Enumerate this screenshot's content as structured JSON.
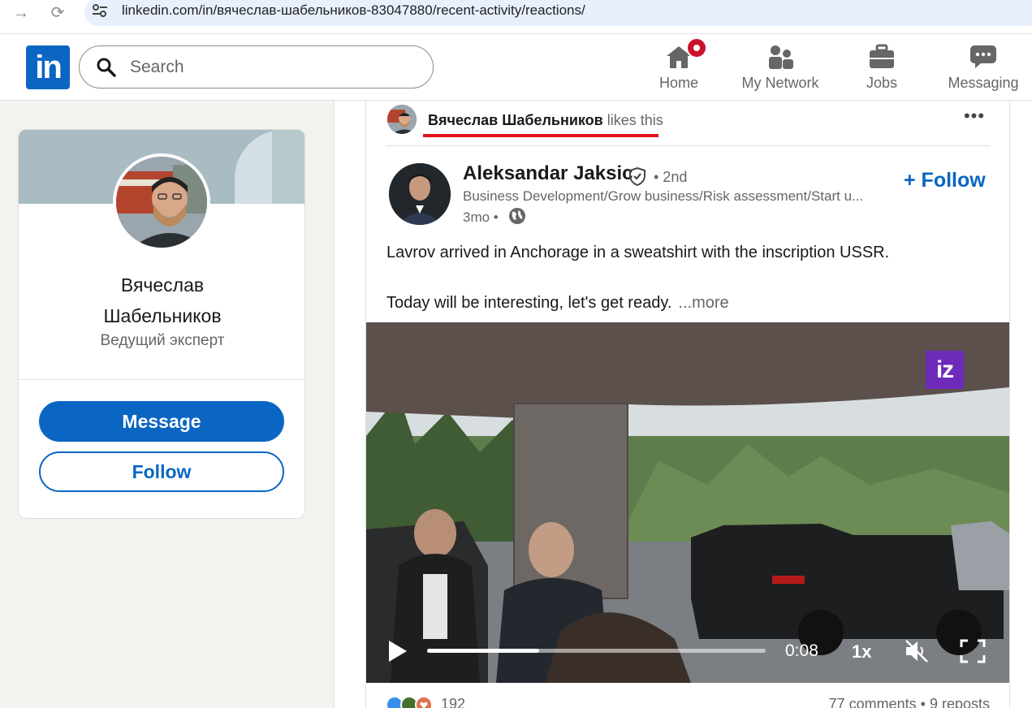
{
  "browser": {
    "url": "linkedin.com/in/вячеслав-шабельников-83047880/recent-activity/reactions/"
  },
  "header": {
    "logo_text": "in",
    "search_placeholder": "Search",
    "nav": {
      "home": "Home",
      "network": "My Network",
      "jobs": "Jobs",
      "messaging": "Messaging"
    }
  },
  "profile": {
    "name_line1": "Вячеслав",
    "name_line2": "Шабельников",
    "title": "Ведущий эксперт",
    "message_label": "Message",
    "follow_label": "Follow"
  },
  "post": {
    "liker_name": "Вячеслав Шабельников",
    "liker_suffix": " likes this",
    "author_name": "Aleksandar Jaksic",
    "degree": "• 2nd",
    "headline": "Business Development/Grow business/Risk assessment/Start u...",
    "time": "3mo •",
    "follow_label": "Follow",
    "text_line1": "Lavrov arrived in Anchorage in a sweatshirt with the inscription USSR.",
    "text_line2": "Today will be interesting, let's get ready.",
    "see_more": "...more",
    "video": {
      "logo": "iz",
      "time": "0:08",
      "speed": "1x",
      "progress": 0.33
    },
    "reaction_count": "192",
    "comments_reposts": "77 comments • 9 reposts"
  },
  "colors": {
    "brand_blue": "#0a66c2",
    "notification_red": "#cb112d",
    "highlight_red": "#e3141a",
    "video_logo_purple": "#6e2ab8"
  }
}
